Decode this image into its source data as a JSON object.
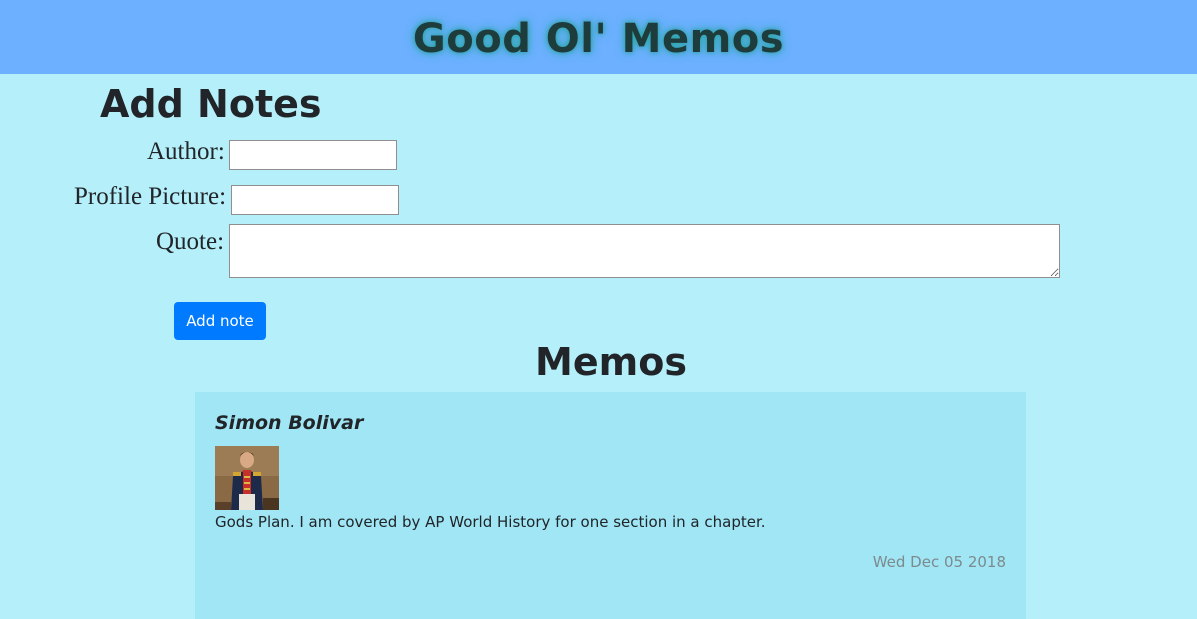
{
  "header": {
    "title": "Good Ol' Memos"
  },
  "form": {
    "title": "Add Notes",
    "author_label": "Author:",
    "author_value": "",
    "profile_label": "Profile Picture:",
    "profile_value": "",
    "quote_label": "Quote:",
    "quote_value": "",
    "submit_label": "Add note"
  },
  "memos": {
    "title": "Memos",
    "items": [
      {
        "author": "Simon Bolivar",
        "quote": "Gods Plan. I am covered by AP World History for one section in a chapter.",
        "date": "Wed Dec 05 2018"
      }
    ]
  },
  "colors": {
    "header_bg": "#6cb0ff",
    "page_bg": "#b5f0fa",
    "card_bg": "#a0e6f4",
    "button_bg": "#007bff"
  }
}
